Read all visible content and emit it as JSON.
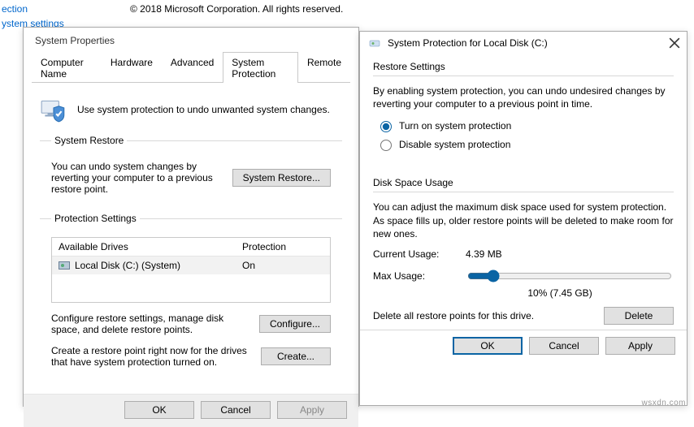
{
  "background": {
    "link1": "ection",
    "link2": "ystem settings",
    "copyright": "© 2018 Microsoft Corporation. All rights reserved."
  },
  "sysprop": {
    "title": "System Properties",
    "tabs": {
      "computer_name": "Computer Name",
      "hardware": "Hardware",
      "advanced": "Advanced",
      "system_protection": "System Protection",
      "remote": "Remote"
    },
    "intro": "Use system protection to undo unwanted system changes.",
    "system_restore": {
      "legend": "System Restore",
      "text": "You can undo system changes by reverting your computer to a previous restore point.",
      "button": "System Restore..."
    },
    "protection_settings": {
      "legend": "Protection Settings",
      "col_drive": "Available Drives",
      "col_prot": "Protection",
      "drive_name": "Local Disk (C:) (System)",
      "drive_prot": "On",
      "configure_text": "Configure restore settings, manage disk space, and delete restore points.",
      "configure_button": "Configure...",
      "create_text": "Create a restore point right now for the drives that have system protection turned on.",
      "create_button": "Create..."
    },
    "buttons": {
      "ok": "OK",
      "cancel": "Cancel",
      "apply": "Apply"
    }
  },
  "sysprot": {
    "title": "System Protection for Local Disk (C:)",
    "restore": {
      "legend": "Restore Settings",
      "para": "By enabling system protection, you can undo undesired changes by reverting your computer to a previous point in time.",
      "opt_on": "Turn on system protection",
      "opt_off": "Disable system protection"
    },
    "disk": {
      "legend": "Disk Space Usage",
      "para": "You can adjust the maximum disk space used for system protection. As space fills up, older restore points will be deleted to make room for new ones.",
      "current_label": "Current Usage:",
      "current_value": "4.39 MB",
      "max_label": "Max Usage:",
      "slider_caption": "10% (7.45 GB)",
      "delete_text": "Delete all restore points for this drive.",
      "delete_button": "Delete"
    },
    "buttons": {
      "ok": "OK",
      "cancel": "Cancel",
      "apply": "Apply"
    }
  },
  "watermark": "wsxdn.com"
}
